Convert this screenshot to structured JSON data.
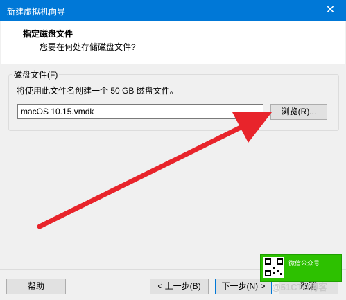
{
  "window": {
    "title": "新建虚拟机向导",
    "close_glyph": "✕"
  },
  "header": {
    "title": "指定磁盘文件",
    "subtitle": "您要在何处存储磁盘文件?"
  },
  "disk_file": {
    "group_label": "磁盘文件(F)",
    "description": "将使用此文件名创建一个 50 GB 磁盘文件。",
    "filename": "macOS 10.15.vmdk",
    "browse_label": "浏览(R)..."
  },
  "footer": {
    "help_label": "帮助",
    "back_label": "< 上一步(B)",
    "next_label": "下一步(N) >",
    "cancel_label": "取消"
  },
  "overlay": {
    "wechat_label": "微信公众号",
    "watermark": "@51CTO博客"
  },
  "colors": {
    "titlebar": "#0078d7",
    "arrow": "#e8242b",
    "qr_green": "#2dc100"
  },
  "icons": {
    "close": "close-icon",
    "arrow": "red-arrow-annotation",
    "qr": "qr-code-icon"
  }
}
